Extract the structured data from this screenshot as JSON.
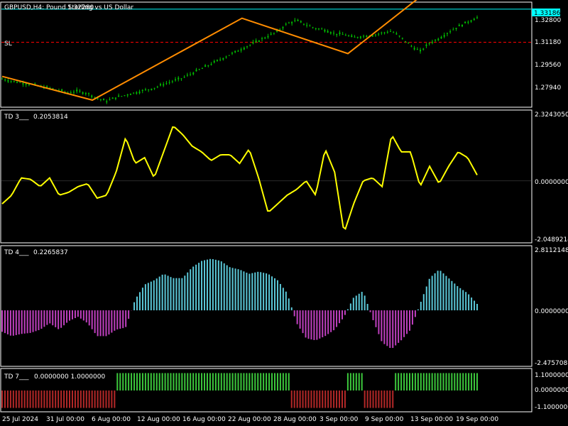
{
  "theme": {
    "background": "#000000",
    "panel_border": "#ffffff",
    "candle_up": "#00c000",
    "zigzag": "#ff8c00",
    "price_line": "#00ffff",
    "sl_line": "#ff0000",
    "td3_line": "#ffff00",
    "td4_positive": "#5bc8d8",
    "td4_negative": "#c040c0",
    "td7_positive": "#3cc83c",
    "td7_negative": "#b42828"
  },
  "main": {
    "title": "GBPUSD,H4:  Pound Sterling vs US Dollar",
    "ohlc_fragment": "1.32280",
    "sl_label": "SL",
    "current_price": "1.33186",
    "y_labels": [
      "1.32800",
      "1.31180",
      "1.29560",
      "1.27940"
    ]
  },
  "td3": {
    "label": "TD 3___",
    "value": "0.2053814",
    "y_labels": [
      "2.3243050",
      "0.0000000",
      "-2.0489214"
    ]
  },
  "td4": {
    "label": "TD 4___",
    "value": "0.2265837",
    "y_labels": [
      "2.8112148",
      "0.0000000",
      "-2.4757087"
    ]
  },
  "td7": {
    "label": "TD 7___",
    "values": "0.0000000  1.0000000",
    "y_labels": [
      "1.1000000",
      "0.0000000",
      "-1.1000000"
    ]
  },
  "time_axis": [
    "25 Jul 2024",
    "31 Jul 00:00",
    "6 Aug 00:00",
    "12 Aug 00:00",
    "16 Aug 00:00",
    "22 Aug 00:00",
    "28 Aug 00:00",
    "3 Sep 00:00",
    "9 Sep 00:00",
    "13 Sep 00:00",
    "19 Sep 00:00"
  ],
  "chart_data": [
    {
      "type": "line",
      "name": "GBPUSD H4 price (approximate close path)",
      "x": [
        0.0,
        0.02,
        0.04,
        0.06,
        0.08,
        0.1,
        0.12,
        0.14,
        0.16,
        0.18,
        0.2,
        0.22,
        0.24,
        0.26,
        0.28,
        0.3,
        0.32,
        0.34,
        0.36,
        0.38,
        0.4,
        0.42,
        0.44,
        0.46,
        0.48,
        0.5,
        0.52,
        0.54,
        0.56,
        0.58,
        0.6,
        0.62,
        0.64,
        0.66,
        0.68,
        0.7,
        0.72,
        0.74,
        0.76,
        0.78,
        0.8,
        0.82,
        0.84,
        0.86,
        0.88,
        0.9,
        0.92,
        0.94,
        0.96,
        0.98,
        1.0
      ],
      "y": [
        1.287,
        1.2855,
        1.2845,
        1.2835,
        1.282,
        1.281,
        1.2795,
        1.278,
        1.279,
        1.2775,
        1.2745,
        1.2725,
        1.275,
        1.2765,
        1.278,
        1.2795,
        1.281,
        1.2835,
        1.2855,
        1.2875,
        1.2905,
        1.2935,
        1.2965,
        1.2995,
        1.3025,
        1.3055,
        1.3085,
        1.3115,
        1.3145,
        1.3175,
        1.3225,
        1.3245,
        1.3218,
        1.3195,
        1.3185,
        1.316,
        1.3155,
        1.3135,
        1.3145,
        1.315,
        1.3165,
        1.3178,
        1.3135,
        1.3085,
        1.3045,
        1.31,
        1.313,
        1.317,
        1.3205,
        1.3235,
        1.3265
      ],
      "zigzag_points": [
        [
          0.0,
          1.2885
        ],
        [
          0.19,
          1.2732
        ],
        [
          0.505,
          1.326
        ],
        [
          0.728,
          1.3032
        ],
        [
          0.883,
          1.3405
        ]
      ],
      "ylim": [
        1.27,
        1.335
      ],
      "current": 1.33186,
      "stop_loss": 1.3105
    },
    {
      "type": "line",
      "name": "TD 3",
      "x": [
        0.0,
        0.02,
        0.04,
        0.06,
        0.08,
        0.1,
        0.12,
        0.14,
        0.16,
        0.18,
        0.2,
        0.22,
        0.24,
        0.26,
        0.28,
        0.3,
        0.32,
        0.34,
        0.36,
        0.38,
        0.4,
        0.42,
        0.44,
        0.46,
        0.48,
        0.5,
        0.52,
        0.54,
        0.56,
        0.58,
        0.6,
        0.62,
        0.64,
        0.66,
        0.68,
        0.7,
        0.72,
        0.74,
        0.76,
        0.78,
        0.8,
        0.82,
        0.84,
        0.86,
        0.88,
        0.9,
        0.92,
        0.94,
        0.96,
        0.98,
        1.0
      ],
      "y": [
        -0.8,
        -0.5,
        0.1,
        0.05,
        -0.2,
        0.1,
        -0.5,
        -0.4,
        -0.2,
        -0.1,
        -0.6,
        -0.5,
        0.3,
        1.5,
        0.6,
        0.8,
        0.1,
        1.0,
        1.9,
        1.6,
        1.2,
        1.0,
        0.7,
        0.9,
        0.9,
        0.6,
        1.1,
        0.1,
        -1.1,
        -0.8,
        -0.5,
        -0.3,
        0.0,
        -0.5,
        1.1,
        0.3,
        -1.8,
        -0.8,
        0.0,
        0.1,
        -0.2,
        1.6,
        1.0,
        1.0,
        -0.2,
        0.5,
        -0.1,
        0.5,
        1.0,
        0.8,
        0.2
      ],
      "ylim": [
        -2.0489214,
        2.324305
      ]
    },
    {
      "type": "bar",
      "name": "TD 4",
      "x_range": [
        0,
        1
      ],
      "values": [
        -1.0,
        -1.2,
        -1.1,
        -1.05,
        -0.9,
        -0.6,
        -0.9,
        -0.5,
        -0.3,
        -0.6,
        -1.2,
        -1.2,
        -0.9,
        -0.8,
        0.5,
        1.2,
        1.4,
        1.7,
        1.5,
        1.5,
        2.0,
        2.3,
        2.4,
        2.3,
        2.0,
        1.9,
        1.7,
        1.8,
        1.7,
        1.4,
        0.8,
        -0.6,
        -1.3,
        -1.4,
        -1.2,
        -0.9,
        -0.3,
        0.6,
        0.9,
        -0.4,
        -1.5,
        -1.8,
        -1.4,
        -0.9,
        0.3,
        1.5,
        1.9,
        1.5,
        1.1,
        0.8,
        0.3
      ],
      "ylim": [
        -2.4757087,
        2.8112148
      ]
    },
    {
      "type": "bar",
      "name": "TD 7",
      "segments": [
        {
          "x_start": 0.0,
          "x_end": 0.238,
          "value": -1
        },
        {
          "x_start": 0.238,
          "x_end": 0.606,
          "value": 1
        },
        {
          "x_start": 0.606,
          "x_end": 0.723,
          "value": -1
        },
        {
          "x_start": 0.723,
          "x_end": 0.758,
          "value": 1
        },
        {
          "x_start": 0.758,
          "x_end": 0.824,
          "value": -1
        },
        {
          "x_start": 0.824,
          "x_end": 1.0,
          "value": 1
        }
      ],
      "ylim": [
        -1.1,
        1.1
      ]
    }
  ]
}
